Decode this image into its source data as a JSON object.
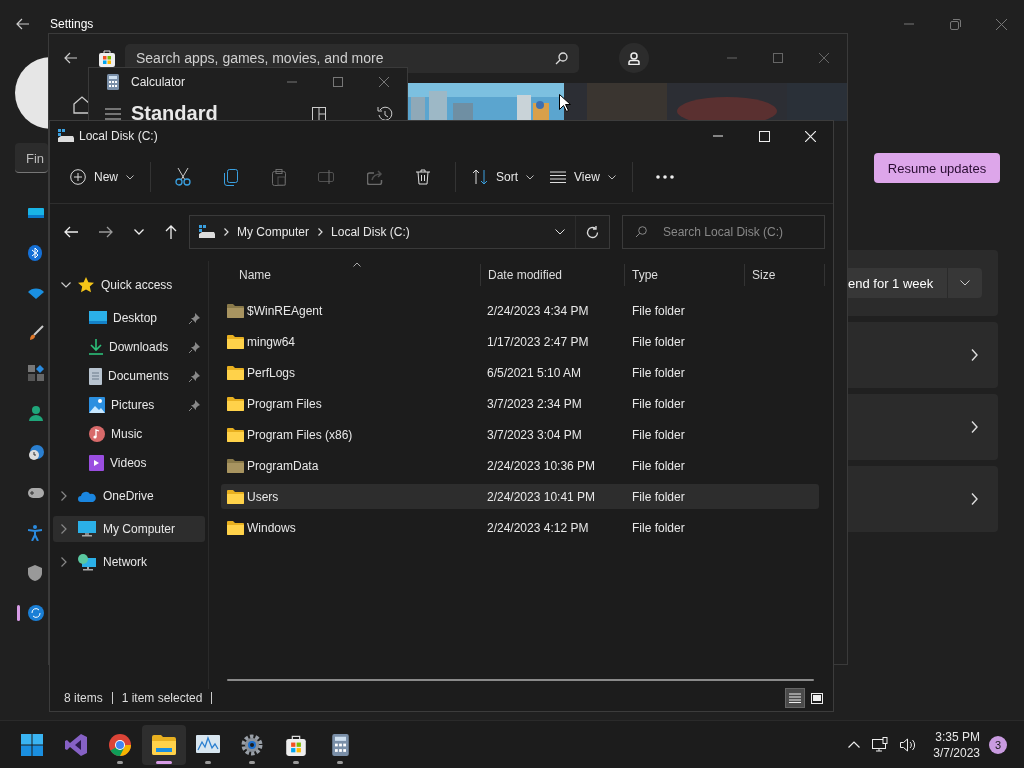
{
  "settings": {
    "title": "Settings",
    "search_placeholder": "Fin",
    "nav": [
      {
        "kind": "system",
        "selected": false
      },
      {
        "kind": "bluetooth",
        "selected": false
      },
      {
        "kind": "network",
        "selected": false
      },
      {
        "kind": "personalization",
        "selected": false
      },
      {
        "kind": "apps",
        "selected": false
      },
      {
        "kind": "accounts",
        "selected": false
      },
      {
        "kind": "time",
        "selected": false
      },
      {
        "kind": "gaming",
        "selected": false
      },
      {
        "kind": "accessibility",
        "selected": false
      },
      {
        "kind": "privacy",
        "selected": false
      },
      {
        "kind": "update",
        "selected": true
      }
    ],
    "resume_button": "Resume updates",
    "pause_option": "end for 1 week"
  },
  "store": {
    "search_placeholder": "Search apps, games, movies, and more"
  },
  "calculator": {
    "title": "Calculator",
    "mode": "Standard"
  },
  "explorer": {
    "title": "Local Disk (C:)",
    "toolbar": [
      [
        {
          "kind": "new",
          "label": "New",
          "dropdown": true,
          "disabled": false
        }
      ],
      [
        {
          "kind": "cut",
          "disabled": false
        },
        {
          "kind": "copy",
          "disabled": false
        },
        {
          "kind": "paste",
          "disabled": true
        },
        {
          "kind": "rename",
          "disabled": true
        },
        {
          "kind": "share",
          "disabled": true
        },
        {
          "kind": "delete",
          "disabled": false
        }
      ],
      [
        {
          "kind": "sort",
          "label": "Sort",
          "dropdown": true,
          "disabled": false
        },
        {
          "kind": "view",
          "label": "View",
          "dropdown": true,
          "disabled": false
        }
      ],
      [
        {
          "kind": "more",
          "disabled": false
        }
      ]
    ],
    "breadcrumb": [
      "My Computer",
      "Local Disk (C:)"
    ],
    "search_placeholder": "Search Local Disk (C:)",
    "nav": [
      {
        "label": "Quick access",
        "kind": "star",
        "expanded": true,
        "selected": false,
        "children": [
          {
            "label": "Desktop",
            "kind": "desktop",
            "pinned": true,
            "selected": false
          },
          {
            "label": "Downloads",
            "kind": "downloads",
            "pinned": true,
            "selected": false
          },
          {
            "label": "Documents",
            "kind": "documents",
            "pinned": true,
            "selected": false
          },
          {
            "label": "Pictures",
            "kind": "pictures",
            "pinned": true,
            "selected": false
          },
          {
            "label": "Music",
            "kind": "music",
            "pinned": false,
            "selected": false
          },
          {
            "label": "Videos",
            "kind": "videos",
            "pinned": false,
            "selected": false
          }
        ]
      },
      {
        "label": "OneDrive",
        "kind": "cloud",
        "expanded": false,
        "selected": false
      },
      {
        "label": "My Computer",
        "kind": "computer",
        "expanded": false,
        "selected": true
      },
      {
        "label": "Network",
        "kind": "network",
        "expanded": false,
        "selected": false
      }
    ],
    "columns": [
      {
        "label": "Name",
        "sorted": true
      },
      {
        "label": "Date modified",
        "sorted": false
      },
      {
        "label": "Type",
        "sorted": false
      },
      {
        "label": "Size",
        "sorted": false
      }
    ],
    "rows": [
      {
        "name": "$WinREAgent",
        "date": "2/24/2023 4:34 PM",
        "type": "File folder",
        "hidden": true,
        "selected": false
      },
      {
        "name": "mingw64",
        "date": "1/17/2023 2:47 PM",
        "type": "File folder",
        "hidden": false,
        "selected": false
      },
      {
        "name": "PerfLogs",
        "date": "6/5/2021 5:10 AM",
        "type": "File folder",
        "hidden": false,
        "selected": false
      },
      {
        "name": "Program Files",
        "date": "3/7/2023 2:34 PM",
        "type": "File folder",
        "hidden": false,
        "selected": false
      },
      {
        "name": "Program Files (x86)",
        "date": "3/7/2023 3:04 PM",
        "type": "File folder",
        "hidden": false,
        "selected": false
      },
      {
        "name": "ProgramData",
        "date": "2/24/2023 10:36 PM",
        "type": "File folder",
        "hidden": true,
        "selected": false
      },
      {
        "name": "Users",
        "date": "2/24/2023 10:41 PM",
        "type": "File folder",
        "hidden": false,
        "selected": true
      },
      {
        "name": "Windows",
        "date": "2/24/2023 4:12 PM",
        "type": "File folder",
        "hidden": false,
        "selected": false
      }
    ],
    "status": {
      "count": "8 items",
      "selection": "1 item selected"
    },
    "views": [
      {
        "kind": "details",
        "selected": true
      },
      {
        "kind": "tiles",
        "selected": false
      }
    ]
  },
  "taskbar": {
    "apps": [
      {
        "kind": "start",
        "running": false,
        "active": false
      },
      {
        "kind": "vs",
        "running": false,
        "active": false
      },
      {
        "kind": "chrome",
        "running": true,
        "active": false
      },
      {
        "kind": "explorer",
        "running": true,
        "active": true
      },
      {
        "kind": "perfmon",
        "running": true,
        "active": false
      },
      {
        "kind": "settings",
        "running": true,
        "active": false
      },
      {
        "kind": "store",
        "running": true,
        "active": false
      },
      {
        "kind": "calculator",
        "running": true,
        "active": false
      }
    ],
    "time": "3:35 PM",
    "date": "3/7/2023",
    "badge": "3"
  }
}
